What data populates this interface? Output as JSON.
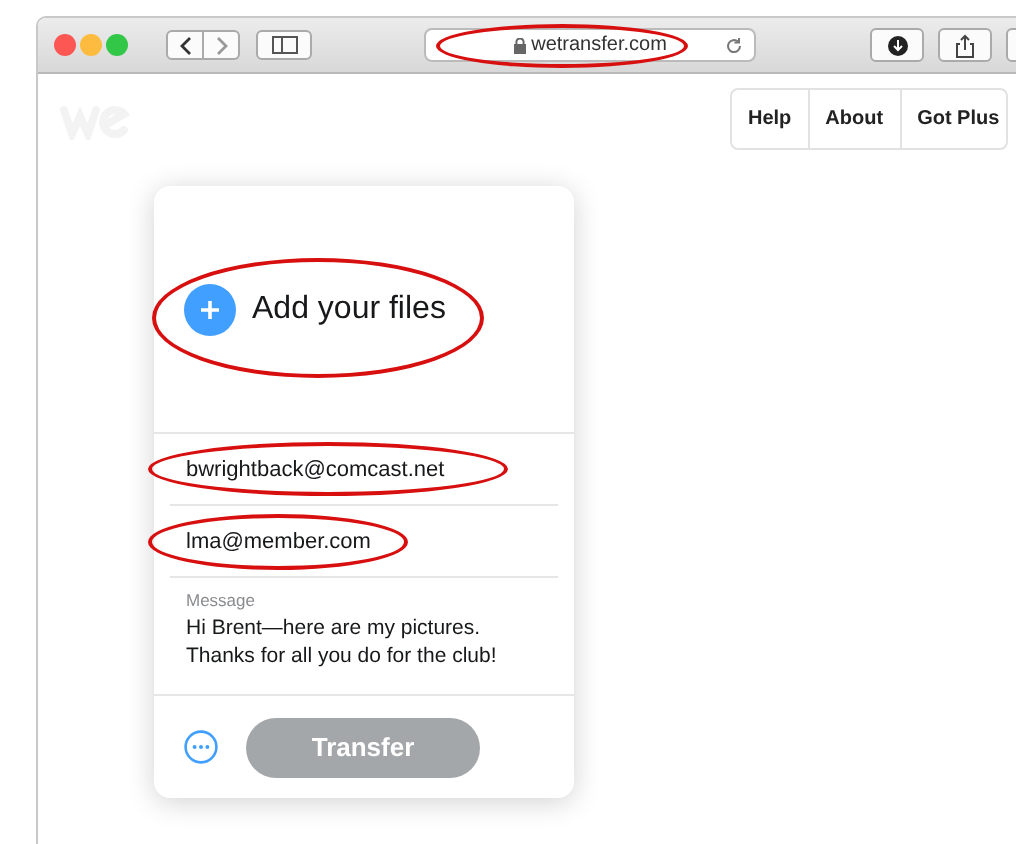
{
  "browser": {
    "url": "wetransfer.com"
  },
  "nav": [
    {
      "label": "Help"
    },
    {
      "label": "About"
    },
    {
      "label": "Got Plus"
    }
  ],
  "card": {
    "add_files": {
      "label": "Add your files"
    },
    "recipients": [
      {
        "value": "bwrightback@comcast.net"
      },
      {
        "value": "lma@member.com"
      }
    ],
    "message": {
      "label": "Message",
      "value": "Hi Brent—here are my pictures.\nThanks for all you do for the club!"
    },
    "transfer": {
      "label": "Transfer",
      "disabled": true
    }
  }
}
